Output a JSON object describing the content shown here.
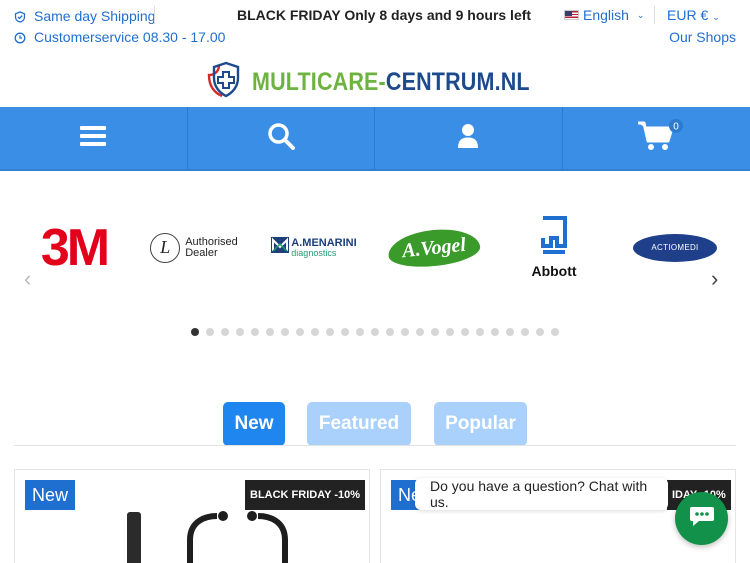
{
  "topbar": {
    "shipping": "Same day Shipping",
    "service": "Customerservice 08.30 - 17.00",
    "promo": "BLACK FRIDAY Only 8 days and 9 hours left",
    "language": "English",
    "currency": "EUR €",
    "shops": "Our Shops"
  },
  "logo": {
    "part1": "MULTICARE-",
    "part2": "CENTRUM.NL"
  },
  "nav": {
    "cart_count": "0"
  },
  "brands": {
    "b1": "3M",
    "b2_line1": "Authorised",
    "b2_line2": "Dealer",
    "b3_line1": "A.MENARINI",
    "b3_line2": "diagnostics",
    "b4": "A.Vogel",
    "b5": "Abbott",
    "b6": "ACTIOMEDI"
  },
  "carousel": {
    "dot_count": 25,
    "active_index": 0
  },
  "tabs": {
    "new": "New",
    "featured": "Featured",
    "popular": "Popular"
  },
  "products": [
    {
      "badge": "New",
      "deal": "BLACK FRIDAY -10%"
    },
    {
      "badge": "Ne",
      "deal": "IDAY -10%"
    }
  ],
  "chat": {
    "prompt": "Do you have a question? Chat with us."
  },
  "colors": {
    "accent": "#3a8ee6",
    "brand_blue": "#1d4a8c",
    "brand_green": "#6cb33f",
    "chat": "#12914a"
  }
}
